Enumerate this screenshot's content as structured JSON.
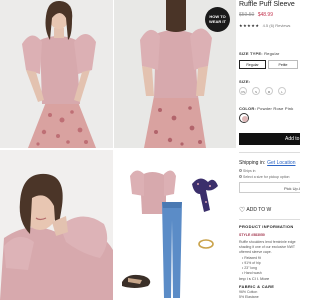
{
  "colors": {
    "sweater_pink": "#d7a9ad",
    "skirt": "#d9a2a0",
    "price_sale": "#c2334d",
    "link": "#2a64c4",
    "add_button": "#111111"
  },
  "gallery": {
    "badge": [
      "HOW TO",
      "WEAR IT"
    ],
    "images": [
      {
        "name": "model-front-photo"
      },
      {
        "name": "model-side-photo"
      },
      {
        "name": "model-closeup-photo"
      },
      {
        "name": "outfit-flatlay-photo"
      }
    ]
  },
  "product": {
    "title": "Ruffle Puff Sleeve",
    "price_old": "$59.50",
    "price_new": "$48.99",
    "stars": "★★★★★",
    "rating_text": "4.5 (6) Reviews",
    "size_type_label": "SIZE TYPE:",
    "size_type_value": "Regular",
    "size_types": [
      "Regular",
      "Petite"
    ],
    "size_label": "SIZE:",
    "sizes": [
      "XS",
      "S",
      "M",
      "L"
    ],
    "color_label": "COLOR:",
    "color_value": "Powder Rose Pink",
    "add_label": "Add to",
    "shipping_label": "Shipping in:",
    "shipping_link": "Get Location",
    "ship_option": "Ships in",
    "store_option": "Select a size for pickup option",
    "pickup_label": "Pick Up A",
    "wishlist_label": "ADD TO W",
    "info_title": "PRODUCT INFORMATION",
    "style_label": "STYLE #583050",
    "desc_lines": [
      "Ruffle shoulders lend femininle edge",
      "shading it one of our exclusive NWT",
      "ofterred sleeve cape."
    ],
    "bullets": [
      "Relaxed fit",
      "91% of hip",
      "23\" long",
      "Hand wash"
    ],
    "more_line": "Imp i s  Cl I.  More",
    "fabric_title": "FABRIC & CARE",
    "fabric_lines": [
      "96% Cotton",
      "5% Elastane"
    ]
  }
}
